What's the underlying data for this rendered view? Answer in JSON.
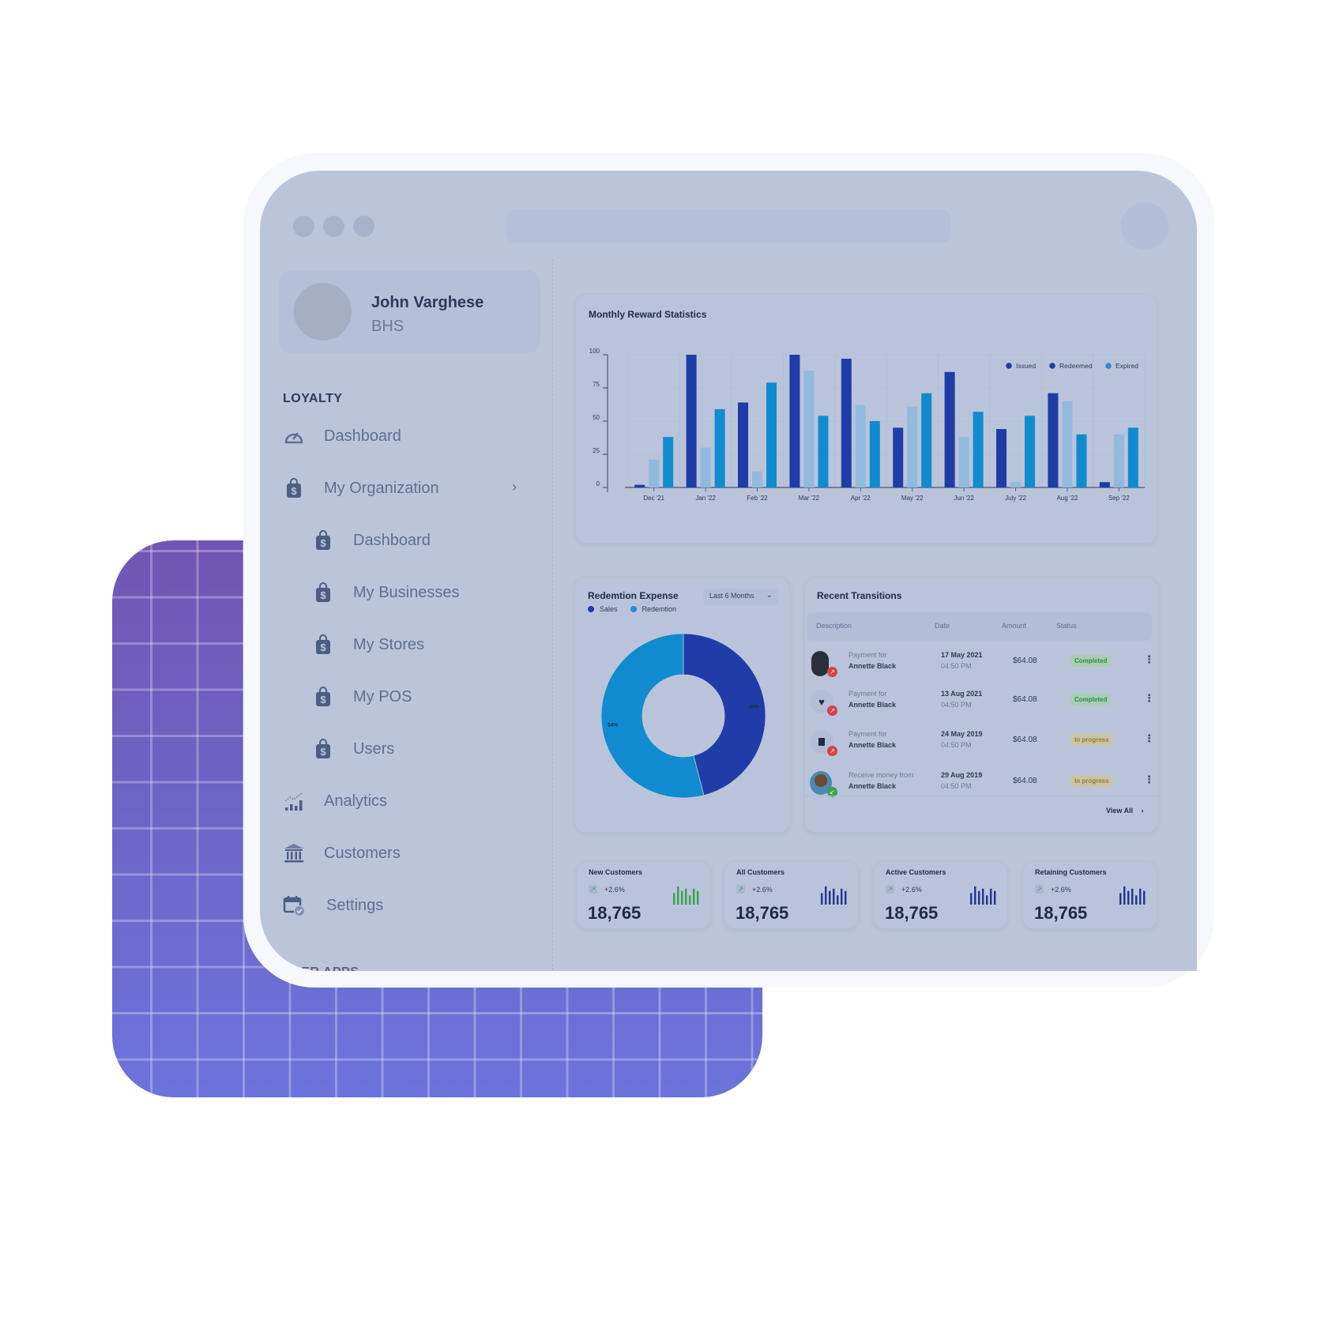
{
  "window": {
    "traffic_lights": [
      "close",
      "minimize",
      "maximize"
    ]
  },
  "profile": {
    "name": "John Varghese",
    "org": "BHS"
  },
  "sidebar": {
    "section_title": "LOYALTY",
    "clipped_section_title": "USER APPS",
    "items": [
      {
        "label": "Dashboard",
        "icon": "gauge-icon"
      },
      {
        "label": "My Organization",
        "icon": "shopping-bag-dollar-icon",
        "chevron": "›"
      },
      {
        "label": "Dashboard",
        "icon": "shopping-bag-dollar-icon",
        "sub": true
      },
      {
        "label": "My Businesses",
        "icon": "shopping-bag-dollar-icon",
        "sub": true
      },
      {
        "label": "My Stores",
        "icon": "shopping-bag-dollar-icon",
        "sub": true
      },
      {
        "label": "My POS",
        "icon": "shopping-bag-dollar-icon",
        "sub": true
      },
      {
        "label": "Users",
        "icon": "shopping-bag-dollar-icon",
        "sub": true
      },
      {
        "label": "Analytics",
        "icon": "analytics-chart-icon"
      },
      {
        "label": "Customers",
        "icon": "bank-building-icon"
      },
      {
        "label": "Settings",
        "icon": "calendar-check-icon"
      }
    ]
  },
  "colors": {
    "issued": "#1f3ca8",
    "redeemed": "#93badd",
    "expired": "#118bd0",
    "sales": "#1f3ca8",
    "redemption": "#118bd0",
    "completed_text": "#2e8c45",
    "progress_text": "#9b7d2c",
    "sparkline_green": "#3aa14a",
    "sparkline_blue": "#1f3591"
  },
  "chart_data": [
    {
      "type": "bar",
      "title": "Monthly Reward Statistics",
      "categories": [
        "Dec '21",
        "Jan '22",
        "Feb '22",
        "Mar '22",
        "Apr '22",
        "May '22",
        "Jun '22",
        "July '22",
        "Aug '22",
        "Sep '22"
      ],
      "series": [
        {
          "name": "Issued",
          "values": [
            2,
            100,
            64,
            100,
            97,
            45,
            87,
            44,
            71,
            4
          ]
        },
        {
          "name": "Redeemed",
          "values": [
            21,
            30,
            12,
            88,
            62,
            61,
            38,
            4,
            65,
            40
          ]
        },
        {
          "name": "Expired",
          "values": [
            38,
            59,
            79,
            54,
            50,
            71,
            57,
            54,
            40,
            45
          ]
        }
      ],
      "legend_labels": [
        "Issued",
        "Redeemed",
        "Expired"
      ],
      "yticks": [
        0,
        25,
        50,
        75,
        100
      ],
      "ylim": [
        0,
        100
      ],
      "xlabel": "",
      "ylabel": "",
      "grid": true,
      "legend_position": "top-right"
    },
    {
      "type": "pie",
      "title": "Redemtion Expense",
      "labels": [
        "Sales",
        "Redemtion"
      ],
      "values": [
        46,
        54
      ],
      "value_labels": [
        "46%",
        "54%"
      ],
      "donut": true,
      "legend_position": "top-left"
    }
  ],
  "donut_card": {
    "title": "Redemtion Expense",
    "period_select": "Last 6 Months",
    "caret": "⌄",
    "legend": [
      "Sales",
      "Redemtion"
    ]
  },
  "bar_card": {
    "title": "Monthly Reward Statistics"
  },
  "transactions": {
    "title": "Recent Transitions",
    "columns": [
      "Description",
      "Date",
      "Amount",
      "Status"
    ],
    "rows": [
      {
        "line1": "Payment for",
        "line2": "Annette Black",
        "date": "17 May 2021",
        "time": "04:50 PM",
        "amount": "$64.08",
        "status": "Completed",
        "avatar": "person-photo",
        "direction": "outgoing"
      },
      {
        "line1": "Payment for",
        "line2": "Annette Black",
        "date": "13 Aug 2021",
        "time": "04:50 PM",
        "amount": "$64.08",
        "status": "Completed",
        "avatar": "heart-icon",
        "direction": "outgoing"
      },
      {
        "line1": "Payment for",
        "line2": "Annette Black",
        "date": "24 May 2019",
        "time": "04:50 PM",
        "amount": "$64.08",
        "status": "In progress",
        "avatar": "book-icon",
        "direction": "outgoing"
      },
      {
        "line1": "Receive money from",
        "line2": "Annette Black",
        "date": "29 Aug 2019",
        "time": "04:50 PM",
        "amount": "$64.08",
        "status": "In progress",
        "avatar": "person-photo",
        "direction": "incoming"
      }
    ],
    "view_all": "View All",
    "view_all_chevron": "›"
  },
  "stats": [
    {
      "label": "New Customers",
      "change": "+2.6%",
      "value": "18,765",
      "spark": [
        3,
        6,
        4,
        5,
        2,
        5,
        4
      ],
      "spark_color": "green"
    },
    {
      "label": "All Customers",
      "change": "+2.6%",
      "value": "18,765",
      "spark": [
        3,
        6,
        4,
        5,
        2,
        5,
        4
      ],
      "spark_color": "blue"
    },
    {
      "label": "Active Customers",
      "change": "+2.6%",
      "value": "18,765",
      "spark": [
        3,
        6,
        4,
        5,
        2,
        5,
        4
      ],
      "spark_color": "blue"
    },
    {
      "label": "Retaining Customers",
      "change": "+2.6%",
      "value": "18,765",
      "spark": [
        3,
        6,
        4,
        5,
        2,
        5,
        4
      ],
      "spark_color": "blue"
    }
  ]
}
